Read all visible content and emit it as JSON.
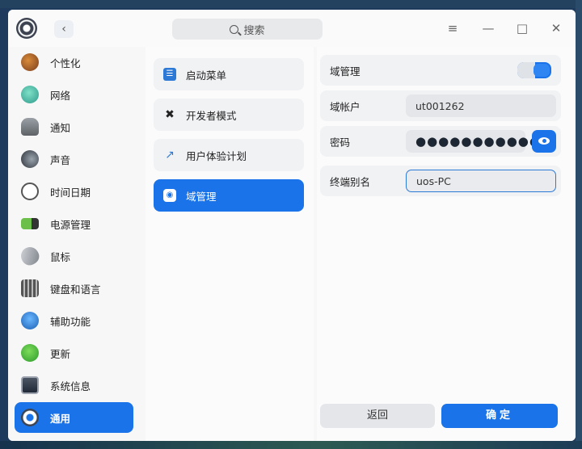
{
  "search": {
    "placeholder": "搜索"
  },
  "colors": {
    "accent": "#1a73e8",
    "sidebar_bg": "#f7f7f7",
    "panel_bg": "#fbfbfb"
  },
  "sidebar": {
    "items": [
      {
        "label": "个性化",
        "icon": "personalization-icon",
        "active": false
      },
      {
        "label": "网络",
        "icon": "network-icon",
        "active": false
      },
      {
        "label": "通知",
        "icon": "bell-icon",
        "active": false
      },
      {
        "label": "声音",
        "icon": "speaker-icon",
        "active": false
      },
      {
        "label": "时间日期",
        "icon": "clock-icon",
        "active": false
      },
      {
        "label": "电源管理",
        "icon": "battery-icon",
        "active": false
      },
      {
        "label": "鼠标",
        "icon": "mouse-icon",
        "active": false
      },
      {
        "label": "键盘和语言",
        "icon": "keyboard-icon",
        "active": false
      },
      {
        "label": "辅助功能",
        "icon": "accessibility-icon",
        "active": false
      },
      {
        "label": "更新",
        "icon": "update-icon",
        "active": false
      },
      {
        "label": "系统信息",
        "icon": "system-info-icon",
        "active": false
      },
      {
        "label": "通用",
        "icon": "general-icon",
        "active": true
      }
    ]
  },
  "middle": {
    "items": [
      {
        "label": "启动菜单",
        "icon": "boot-menu-icon",
        "active": false
      },
      {
        "label": "开发者模式",
        "icon": "developer-tools-icon",
        "active": false
      },
      {
        "label": "用户体验计划",
        "icon": "trend-chart-icon",
        "active": false
      },
      {
        "label": "域管理",
        "icon": "domain-icon",
        "active": true
      }
    ]
  },
  "detail": {
    "domain_management_label": "域管理",
    "domain_management_enabled": true,
    "domain_account_label": "域帐户",
    "domain_account_value": "ut001262",
    "password_label": "密码",
    "password_masked": "●●●●●●●●●●●",
    "terminal_alias_label": "终端别名",
    "terminal_alias_value": "uos-PC",
    "cancel_label": "返回",
    "confirm_label": "确定"
  }
}
